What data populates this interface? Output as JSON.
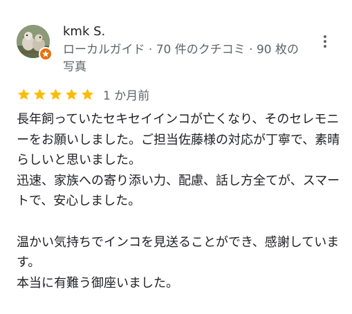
{
  "reviewer": {
    "name": "kmk S.",
    "meta": "ローカルガイド · 70 件のクチコミ · 90 枚の写真",
    "avatar_icon": "bird-photo-avatar",
    "badge_icon": "local-guide-badge-icon"
  },
  "rating": {
    "stars": 5,
    "star_color": "#fbbc04",
    "date": "1 か月前"
  },
  "review": {
    "text": "長年飼っていたセキセイインコが亡くなり、そのセレモニーをお願いしました。ご担当佐藤様の対応が丁寧で、素晴らしいと思いました。\n迅速、家族への寄り添い力、配慮、話し方全てが、スマートで、安心しました。\n\n温かい気持ちでインコを見送ることができ、感謝しています。\n本当に有難う御座いました。"
  },
  "actions": {
    "more_icon": "more-vert-icon"
  }
}
